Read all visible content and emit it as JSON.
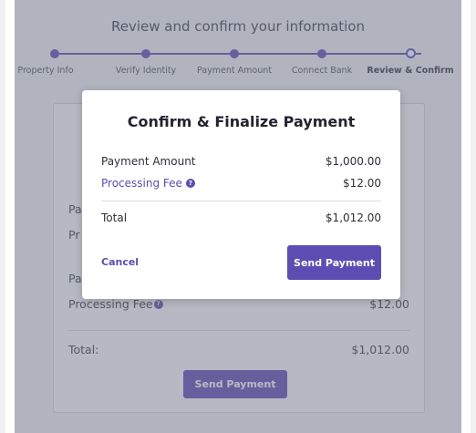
{
  "header": {
    "title": "Review and confirm your information"
  },
  "steps": [
    {
      "label": "Property Info",
      "current": false
    },
    {
      "label": "Verify Identity",
      "current": false
    },
    {
      "label": "Payment Amount",
      "current": false
    },
    {
      "label": "Connect Bank",
      "current": false
    },
    {
      "label": "Review & Confirm",
      "current": true
    }
  ],
  "background_card": {
    "partial_1": "Pa",
    "partial_2": "Pr",
    "partial_3": "Pa",
    "processing_fee_label": "Processing Fee",
    "processing_fee_value": "$12.00",
    "total_label": "Total:",
    "total_value": "$1,012.00",
    "send_label": "Send Payment"
  },
  "modal": {
    "title": "Confirm & Finalize Payment",
    "payment_amount_label": "Payment Amount",
    "payment_amount_value": "$1,000.00",
    "processing_fee_label": "Processing Fee",
    "processing_fee_value": "$12.00",
    "help_icon_glyph": "?",
    "total_label": "Total",
    "total_value": "$1,012.00",
    "cancel_label": "Cancel",
    "send_label": "Send Payment"
  },
  "colors": {
    "accent": "#5d4db3",
    "overlay": "rgba(110,115,135,0.5)"
  }
}
